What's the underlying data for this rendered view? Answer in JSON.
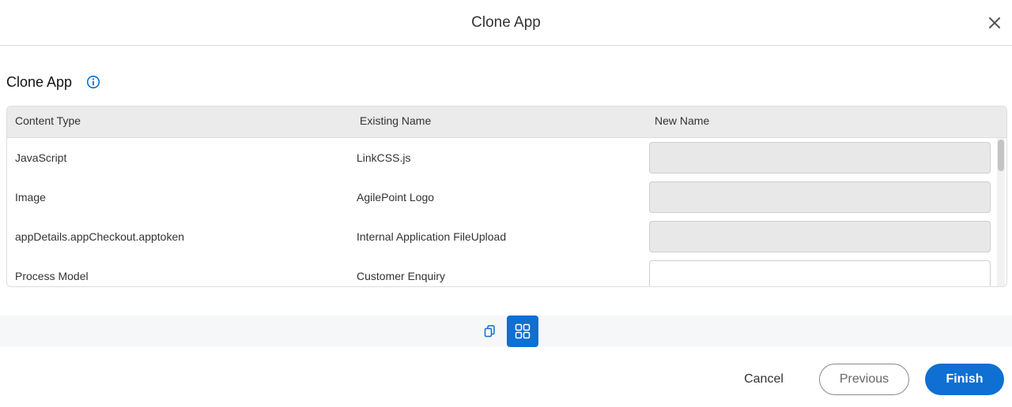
{
  "header": {
    "title": "Clone App",
    "close_icon": "close-icon"
  },
  "section": {
    "title": "Clone App",
    "info_icon": "info-icon"
  },
  "table": {
    "columns": [
      "Content Type",
      "Existing Name",
      "New Name"
    ],
    "rows": [
      {
        "content_type": "JavaScript",
        "existing_name": "LinkCSS.js",
        "new_name": "",
        "editable": false
      },
      {
        "content_type": "Image",
        "existing_name": "AgilePoint Logo",
        "new_name": "",
        "editable": false
      },
      {
        "content_type": "appDetails.appCheckout.apptoken",
        "existing_name": "Internal Application FileUpload",
        "new_name": "",
        "editable": false
      },
      {
        "content_type": "Process Model",
        "existing_name": "Customer Enquiry",
        "new_name": "",
        "editable": true
      }
    ]
  },
  "view_toggle": {
    "items": [
      {
        "icon": "copy-icon",
        "active": false
      },
      {
        "icon": "grid-icon",
        "active": true
      }
    ]
  },
  "footer": {
    "cancel_label": "Cancel",
    "previous_label": "Previous",
    "finish_label": "Finish"
  },
  "colors": {
    "accent": "#0f6fd2",
    "header_bg": "#ebebeb",
    "readonly_input_bg": "#e8e8e8"
  }
}
